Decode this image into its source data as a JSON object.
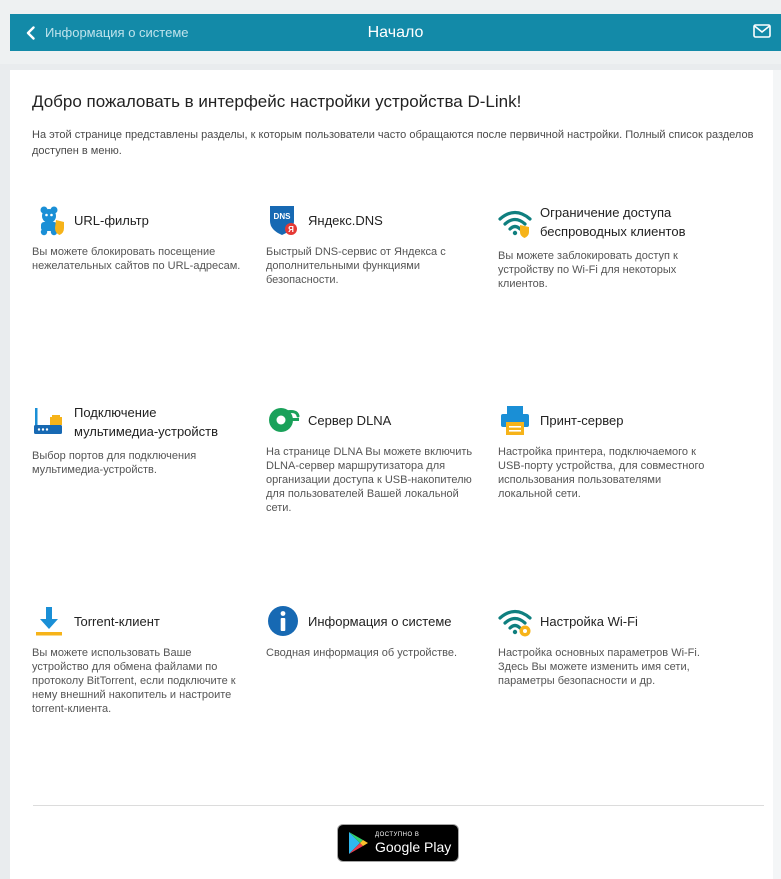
{
  "header": {
    "back_label": "Информация о системе",
    "title": "Начало",
    "mail_icon": "mail-icon"
  },
  "welcome": {
    "title": "Добро пожаловать в интерфейс настройки устройства D-Link!",
    "intro": "На этой странице представлены разделы, к которым пользователи часто обращаются после первичной настройки. Полный список разделов доступен в меню."
  },
  "cards": [
    {
      "title": "URL-фильтр",
      "desc": "Вы можете блокировать посещение нежелательных сайтов по URL-адресам.",
      "icon": "url-filter-icon"
    },
    {
      "title": "Яндекс.DNS",
      "desc": "Быстрый DNS-сервис от Яндекса с дополнительными функциями безопасности.",
      "icon": "yandex-dns-icon",
      "badge": "DNS"
    },
    {
      "title": "Ограничение доступа беспроводных клиентов",
      "desc": "Вы можете заблокировать доступ к устройству по Wi-Fi для некоторых клиентов.",
      "icon": "wifi-restriction-icon"
    },
    {
      "title": "Подключение мультимедиа-устройств",
      "desc": "Выбор портов для подключения мультимедиа-устройств.",
      "icon": "multimedia-ports-icon"
    },
    {
      "title": "Сервер DLNA",
      "desc": "На странице DLNA Вы можете включить DLNA-сервер маршрутизатора для организации доступа к USB-накопителю для пользователей Вашей локальной сети.",
      "icon": "dlna-icon"
    },
    {
      "title": "Принт-сервер",
      "desc": "Настройка принтера, подключаемого к USB-порту устройства, для совместного использования пользователями локальной сети.",
      "icon": "printer-icon"
    },
    {
      "title": "Torrent-клиент",
      "desc": "Вы можете использовать Ваше устройство для обмена файлами по протоколу BitTorrent, если подключите к нему внешний накопитель и настроите torrent-клиента.",
      "icon": "download-icon"
    },
    {
      "title": "Информация о системе",
      "desc": "Сводная информация об устройстве.",
      "icon": "info-icon"
    },
    {
      "title": "Настройка Wi-Fi",
      "desc": "Настройка основных параметров Wi-Fi. Здесь Вы можете изменить имя сети, параметры безопасности и др.",
      "icon": "wifi-settings-icon"
    }
  ],
  "google_play": {
    "small": "ДОСТУПНО В",
    "big": "Google Play",
    "icon": "google-play-icon"
  },
  "colors": {
    "header_bg": "#138aa8",
    "accent_blue": "#1a8fd6",
    "accent_teal": "#0f7f7f",
    "accent_orange": "#f6b319"
  }
}
